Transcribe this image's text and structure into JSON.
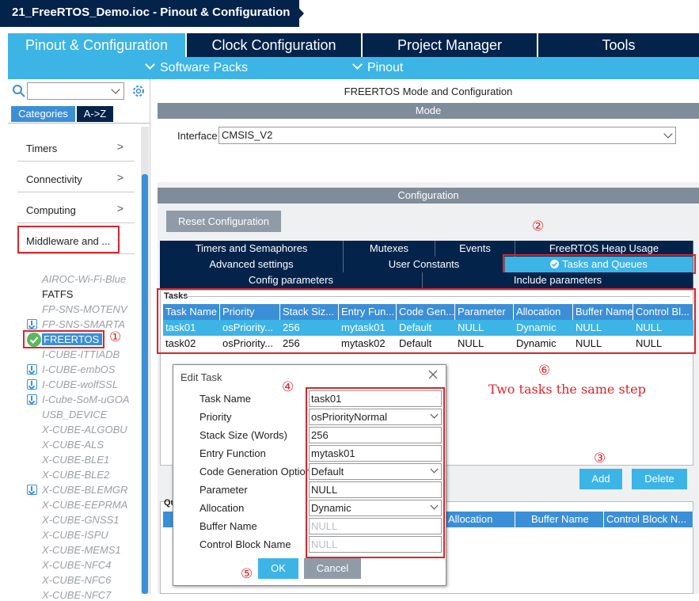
{
  "title_bar": {
    "title": "21_FreeRTOS_Demo.ioc - Pinout & Configuration"
  },
  "main_tabs": [
    {
      "label": "Pinout & Configuration",
      "active": true
    },
    {
      "label": "Clock Configuration"
    },
    {
      "label": "Project Manager"
    },
    {
      "label": "Tools"
    }
  ],
  "sub_tabs": {
    "software_packs": "Software Packs",
    "pinout": "Pinout",
    "chevron_icon": "chevron-down-icon"
  },
  "left_panel": {
    "search_placeholder": "",
    "categories_tab": "Categories",
    "az_tab": "A->Z",
    "categories": [
      "Timers",
      "Connectivity",
      "Computing",
      "Middleware and ..."
    ],
    "middleware_items": [
      {
        "label": "AIROC-Wi-Fi-Blue",
        "style": "disabled"
      },
      {
        "label": "FATFS",
        "style": "normal"
      },
      {
        "label": "FP-SNS-MOTENV",
        "style": "disabled"
      },
      {
        "label": "FP-SNS-SMARTA",
        "style": "disabled",
        "icon": "download-icon"
      },
      {
        "label": "FREERTOS",
        "style": "selected",
        "icon": "check-circle-icon"
      },
      {
        "label": "I-CUBE-ITTIADB",
        "style": "disabled"
      },
      {
        "label": "I-CUBE-embOS",
        "style": "disabled",
        "icon": "download-icon"
      },
      {
        "label": "I-CUBE-wolfSSL",
        "style": "disabled",
        "icon": "download-icon"
      },
      {
        "label": "I-Cube-SoM-uGOA",
        "style": "disabled",
        "icon": "download-icon"
      },
      {
        "label": "USB_DEVICE",
        "style": "disabled"
      },
      {
        "label": "X-CUBE-ALGOBU",
        "style": "disabled"
      },
      {
        "label": "X-CUBE-ALS",
        "style": "disabled"
      },
      {
        "label": "X-CUBE-BLE1",
        "style": "disabled"
      },
      {
        "label": "X-CUBE-BLE2",
        "style": "disabled"
      },
      {
        "label": "X-CUBE-BLEMGR",
        "style": "disabled",
        "icon": "download-icon"
      },
      {
        "label": "X-CUBE-EEPRMA",
        "style": "disabled"
      },
      {
        "label": "X-CUBE-GNSS1",
        "style": "disabled"
      },
      {
        "label": "X-CUBE-ISPU",
        "style": "disabled"
      },
      {
        "label": "X-CUBE-MEMS1",
        "style": "disabled"
      },
      {
        "label": "X-CUBE-NFC4",
        "style": "disabled"
      },
      {
        "label": "X-CUBE-NFC6",
        "style": "disabled"
      },
      {
        "label": "X-CUBE-NFC7",
        "style": "disabled"
      }
    ]
  },
  "right_panel": {
    "header": "FREERTOS Mode and Configuration",
    "mode_header": "Mode",
    "interface_label": "Interface",
    "interface_value": "CMSIS_V2",
    "configuration_header": "Configuration",
    "reset_button": "Reset Configuration",
    "config_tabs_row1": [
      "Timers and Semaphores",
      "Mutexes",
      "Events",
      "FreeRTOS Heap Usage"
    ],
    "config_tabs_row2": [
      "Advanced settings",
      "User Constants",
      "Tasks and Queues"
    ],
    "config_tabs_row3": [
      "Config parameters",
      "Include parameters"
    ],
    "tasks_group_label": "Tasks",
    "task_columns": [
      "Task Name",
      "Priority",
      "Stack Siz...",
      "Entry Fun...",
      "Code Gen...",
      "Parameter",
      "Allocation",
      "Buffer Name",
      "Control Bl..."
    ],
    "tasks": [
      [
        "task01",
        "osPriority...",
        "256",
        "mytask01",
        "Default",
        "NULL",
        "Dynamic",
        "NULL",
        "NULL"
      ],
      [
        "task02",
        "osPriority...",
        "256",
        "mytask02",
        "Default",
        "NULL",
        "Dynamic",
        "NULL",
        "NULL"
      ]
    ],
    "add_button": "Add",
    "delete_button": "Delete",
    "queues_group_label": "Qu",
    "queue_columns_visible": [
      "Allocation",
      "Buffer Name",
      "Control Block N..."
    ]
  },
  "dialog": {
    "title": "Edit Task",
    "fields": [
      {
        "label": "Task Name",
        "value": "task01",
        "type": "text"
      },
      {
        "label": "Priority",
        "value": "osPriorityNormal",
        "type": "select"
      },
      {
        "label": "Stack Size (Words)",
        "value": "256",
        "type": "text"
      },
      {
        "label": "Entry Function",
        "value": "mytask01",
        "type": "text"
      },
      {
        "label": "Code Generation Option",
        "value": "Default",
        "type": "select"
      },
      {
        "label": "Parameter",
        "value": "NULL",
        "type": "text"
      },
      {
        "label": "Allocation",
        "value": "Dynamic",
        "type": "select"
      },
      {
        "label": "Buffer Name",
        "value": "NULL",
        "type": "text-disabled"
      },
      {
        "label": "Control Block Name",
        "value": "NULL",
        "type": "text-disabled"
      }
    ],
    "ok_button": "OK",
    "cancel_button": "Cancel"
  },
  "annotations": {
    "n1": "①",
    "n2": "②",
    "n3": "③",
    "n4": "④",
    "n5": "⑤",
    "n6": "⑥",
    "note6": "Two tasks the same step",
    "color": "#d9262c"
  },
  "colors": {
    "navy": "#03234b",
    "accent": "#3cb4e6",
    "table_header": "#3b8fd6",
    "section_header": "#7f8d9a"
  }
}
